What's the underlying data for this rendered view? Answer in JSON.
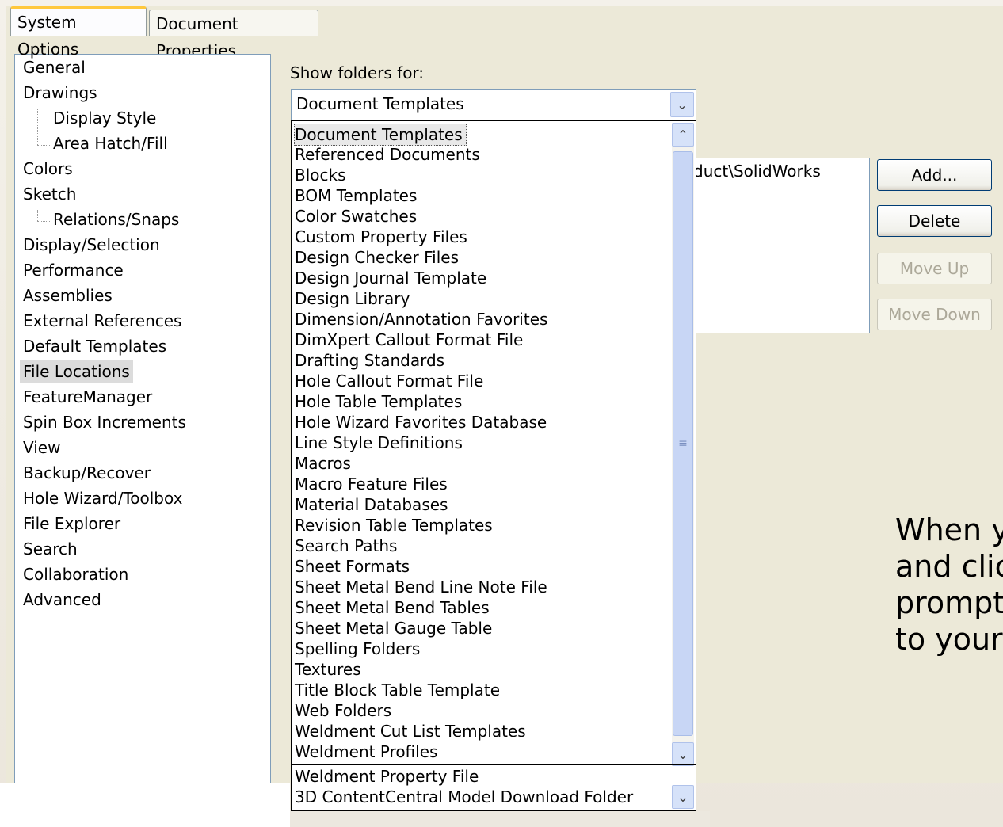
{
  "tabs": [
    {
      "label": "System Options",
      "active": true
    },
    {
      "label": "Document Properties",
      "active": false
    }
  ],
  "tree": {
    "items": [
      {
        "label": "General",
        "level": 0
      },
      {
        "label": "Drawings",
        "level": 0
      },
      {
        "label": "Display Style",
        "level": 1
      },
      {
        "label": "Area Hatch/Fill",
        "level": 1
      },
      {
        "label": "Colors",
        "level": 0
      },
      {
        "label": "Sketch",
        "level": 0
      },
      {
        "label": "Relations/Snaps",
        "level": 1
      },
      {
        "label": "Display/Selection",
        "level": 0
      },
      {
        "label": "Performance",
        "level": 0
      },
      {
        "label": "Assemblies",
        "level": 0
      },
      {
        "label": "External References",
        "level": 0
      },
      {
        "label": "Default Templates",
        "level": 0
      },
      {
        "label": "File Locations",
        "level": 0,
        "selected": true
      },
      {
        "label": "FeatureManager",
        "level": 0
      },
      {
        "label": "Spin Box Increments",
        "level": 0
      },
      {
        "label": "View",
        "level": 0
      },
      {
        "label": "Backup/Recover",
        "level": 0
      },
      {
        "label": "Hole Wizard/Toolbox",
        "level": 0
      },
      {
        "label": "File Explorer",
        "level": 0
      },
      {
        "label": "Search",
        "level": 0
      },
      {
        "label": "Collaboration",
        "level": 0
      },
      {
        "label": "Advanced",
        "level": 0
      }
    ]
  },
  "show_folders": {
    "label": "Show folders for:",
    "selected": "Document Templates"
  },
  "folder_path": "duct\\SolidWorks",
  "buttons": {
    "add": "Add...",
    "delete": "Delete",
    "move_up": "Move Up",
    "move_down": "Move Down"
  },
  "dropdown_options": [
    "Document Templates",
    "Referenced Documents",
    "Blocks",
    "BOM Templates",
    "Color Swatches",
    "Custom Property Files",
    "Design Checker Files",
    "Design Journal Template",
    "Design Library",
    "Dimension/Annotation Favorites",
    "DimXpert Callout Format File",
    "Drafting Standards",
    "Hole Callout Format File",
    "Hole Table Templates",
    "Hole Wizard Favorites Database",
    "Line Style Definitions",
    "Macros",
    "Macro Feature Files",
    "Material Databases",
    "Revision Table Templates",
    "Search Paths",
    "Sheet Formats",
    "Sheet Metal Bend Line Note File",
    "Sheet Metal Bend Tables",
    "Sheet Metal Gauge Table",
    "Spelling Folders",
    "Textures",
    "Title Block Table Template",
    "Web Folders",
    "Weldment Cut List Templates",
    "Weldment Profiles"
  ],
  "extra_options": [
    "Weldment Property File",
    "3D ContentCentral Model Download Folder"
  ],
  "slide_text": [
    "When y",
    "and clic",
    "prompt",
    "to your"
  ],
  "icons": {
    "combo_arrow": "chevron-down-icon",
    "scroll_up": "chevron-up-icon",
    "scroll_down": "chevron-down-icon",
    "thumb_grip": "grip-icon"
  }
}
